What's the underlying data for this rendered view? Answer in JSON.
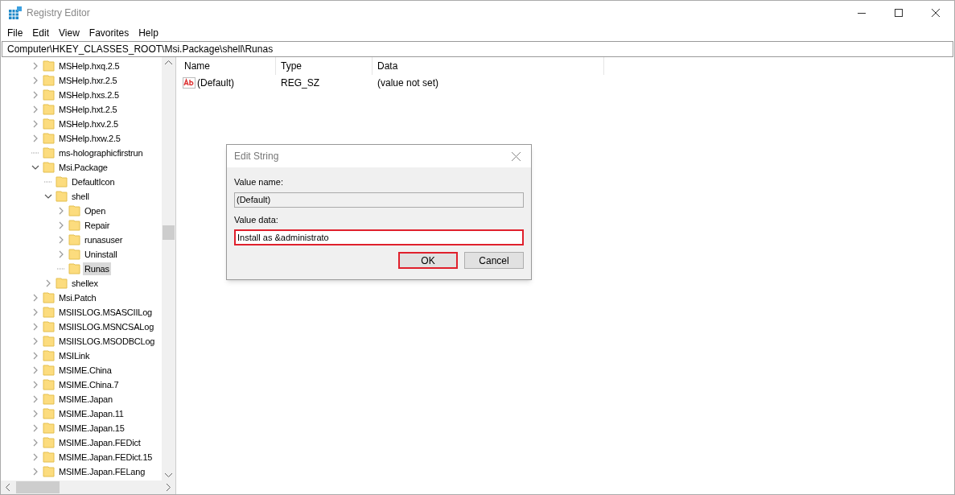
{
  "window": {
    "title": "Registry Editor"
  },
  "menu": [
    "File",
    "Edit",
    "View",
    "Favorites",
    "Help"
  ],
  "address": "Computer\\HKEY_CLASSES_ROOT\\Msi.Package\\shell\\Runas",
  "tree": [
    {
      "label": "MSHelp.hxq.2.5",
      "kind": "branch",
      "expanded": false,
      "selected": false
    },
    {
      "label": "MSHelp.hxr.2.5",
      "kind": "branch",
      "expanded": false,
      "selected": false
    },
    {
      "label": "MSHelp.hxs.2.5",
      "kind": "branch",
      "expanded": false,
      "selected": false
    },
    {
      "label": "MSHelp.hxt.2.5",
      "kind": "branch",
      "expanded": false,
      "selected": false
    },
    {
      "label": "MSHelp.hxv.2.5",
      "kind": "branch",
      "expanded": false,
      "selected": false
    },
    {
      "label": "MSHelp.hxw.2.5",
      "kind": "branch",
      "expanded": false,
      "selected": false
    },
    {
      "label": "ms-holographicfirstrun",
      "kind": "leaf",
      "selected": false
    },
    {
      "label": "Msi.Package",
      "kind": "branch",
      "expanded": true,
      "selected": false,
      "children": [
        {
          "label": "DefaultIcon",
          "kind": "leaf",
          "selected": false
        },
        {
          "label": "shell",
          "kind": "branch",
          "expanded": true,
          "selected": false,
          "children": [
            {
              "label": "Open",
              "kind": "branch",
              "expanded": false,
              "selected": false
            },
            {
              "label": "Repair",
              "kind": "branch",
              "expanded": false,
              "selected": false
            },
            {
              "label": "runasuser",
              "kind": "branch",
              "expanded": false,
              "selected": false
            },
            {
              "label": "Uninstall",
              "kind": "branch",
              "expanded": false,
              "selected": false
            },
            {
              "label": "Runas",
              "kind": "leaf",
              "selected": true
            }
          ]
        },
        {
          "label": "shellex",
          "kind": "branch",
          "expanded": false,
          "selected": false
        }
      ]
    },
    {
      "label": "Msi.Patch",
      "kind": "branch",
      "expanded": false,
      "selected": false
    },
    {
      "label": "MSIISLOG.MSASCIILog",
      "kind": "branch",
      "expanded": false,
      "selected": false
    },
    {
      "label": "MSIISLOG.MSNCSALog",
      "kind": "branch",
      "expanded": false,
      "selected": false
    },
    {
      "label": "MSIISLOG.MSODBCLog",
      "kind": "branch",
      "expanded": false,
      "selected": false
    },
    {
      "label": "MSILink",
      "kind": "branch",
      "expanded": false,
      "selected": false
    },
    {
      "label": "MSIME.China",
      "kind": "branch",
      "expanded": false,
      "selected": false
    },
    {
      "label": "MSIME.China.7",
      "kind": "branch",
      "expanded": false,
      "selected": false
    },
    {
      "label": "MSIME.Japan",
      "kind": "branch",
      "expanded": false,
      "selected": false
    },
    {
      "label": "MSIME.Japan.11",
      "kind": "branch",
      "expanded": false,
      "selected": false
    },
    {
      "label": "MSIME.Japan.15",
      "kind": "branch",
      "expanded": false,
      "selected": false
    },
    {
      "label": "MSIME.Japan.FEDict",
      "kind": "branch",
      "expanded": false,
      "selected": false
    },
    {
      "label": "MSIME.Japan.FEDict.15",
      "kind": "branch",
      "expanded": false,
      "selected": false
    },
    {
      "label": "MSIME.Japan.FELang",
      "kind": "branch",
      "expanded": false,
      "selected": false
    }
  ],
  "values": {
    "columns": [
      "Name",
      "Type",
      "Data"
    ],
    "rows": [
      {
        "name": "(Default)",
        "type": "REG_SZ",
        "data": "(value not set)"
      }
    ]
  },
  "dialog": {
    "title": "Edit String",
    "name_label": "Value name:",
    "name_value": "(Default)",
    "data_label": "Value data:",
    "data_value": "Install as &administrato",
    "data_highlighted": true,
    "buttons": [
      {
        "label": "OK",
        "highlighted": true
      },
      {
        "label": "Cancel",
        "highlighted": false
      }
    ]
  }
}
